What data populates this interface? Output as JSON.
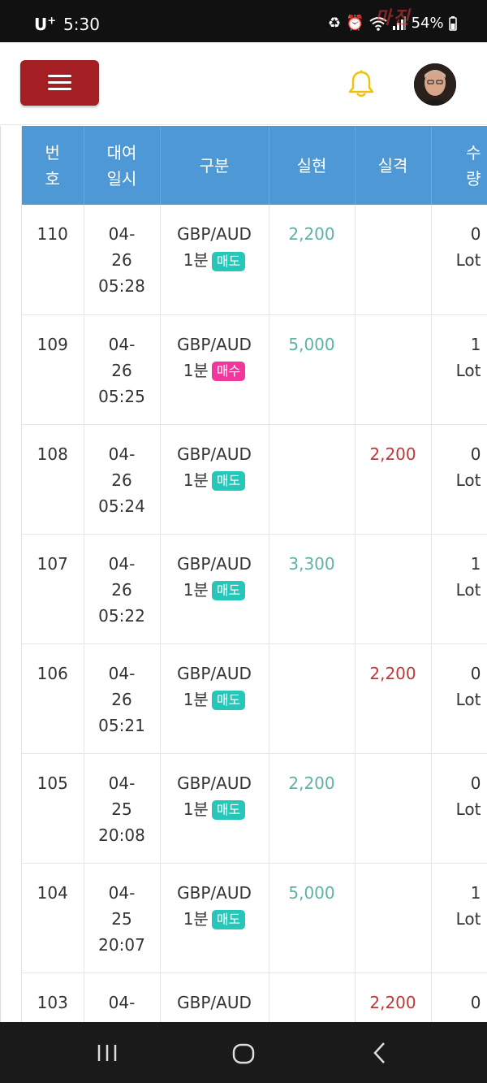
{
  "status": {
    "carrier": "U",
    "carrier_sup": "+",
    "time": "5:30",
    "battery": "54%",
    "watermark": "마진"
  },
  "header": {
    "menu_icon": "hamburger-icon",
    "bell_icon": "bell-icon",
    "avatar_icon": "user-avatar"
  },
  "table": {
    "headers": {
      "no": [
        "번",
        "호"
      ],
      "date": [
        "대여",
        "일시"
      ],
      "type": "구분",
      "gain": "실현",
      "loss": "실격",
      "qty": [
        "수",
        "량"
      ]
    },
    "rows": [
      {
        "no": "110",
        "date": [
          "04-",
          "26",
          "05:28"
        ],
        "pair": "GBP/AUD",
        "period": "1분",
        "side": "매도",
        "side_kind": "sell",
        "gain": "2,200",
        "loss": "",
        "qty": [
          "0",
          "Lot"
        ]
      },
      {
        "no": "109",
        "date": [
          "04-",
          "26",
          "05:25"
        ],
        "pair": "GBP/AUD",
        "period": "1분",
        "side": "매수",
        "side_kind": "buy",
        "gain": "5,000",
        "loss": "",
        "qty": [
          "1",
          "Lot"
        ]
      },
      {
        "no": "108",
        "date": [
          "04-",
          "26",
          "05:24"
        ],
        "pair": "GBP/AUD",
        "period": "1분",
        "side": "매도",
        "side_kind": "sell",
        "gain": "",
        "loss": "2,200",
        "qty": [
          "0",
          "Lot"
        ]
      },
      {
        "no": "107",
        "date": [
          "04-",
          "26",
          "05:22"
        ],
        "pair": "GBP/AUD",
        "period": "1분",
        "side": "매도",
        "side_kind": "sell",
        "gain": "3,300",
        "loss": "",
        "qty": [
          "1",
          "Lot"
        ]
      },
      {
        "no": "106",
        "date": [
          "04-",
          "26",
          "05:21"
        ],
        "pair": "GBP/AUD",
        "period": "1분",
        "side": "매도",
        "side_kind": "sell",
        "gain": "",
        "loss": "2,200",
        "qty": [
          "0",
          "Lot"
        ]
      },
      {
        "no": "105",
        "date": [
          "04-",
          "25",
          "20:08"
        ],
        "pair": "GBP/AUD",
        "period": "1분",
        "side": "매도",
        "side_kind": "sell",
        "gain": "2,200",
        "loss": "",
        "qty": [
          "0",
          "Lot"
        ]
      },
      {
        "no": "104",
        "date": [
          "04-",
          "25",
          "20:07"
        ],
        "pair": "GBP/AUD",
        "period": "1분",
        "side": "매도",
        "side_kind": "sell",
        "gain": "5,000",
        "loss": "",
        "qty": [
          "1",
          "Lot"
        ]
      },
      {
        "no": "103",
        "date": [
          "04-",
          "",
          ""
        ],
        "pair": "GBP/AUD",
        "period": "",
        "side": "",
        "side_kind": "buy",
        "gain": "",
        "loss": "2,200",
        "qty": [
          "0",
          ""
        ]
      }
    ]
  },
  "navbar": {
    "recent_icon": "recent-apps-icon",
    "home_icon": "home-icon",
    "back_icon": "back-icon"
  }
}
